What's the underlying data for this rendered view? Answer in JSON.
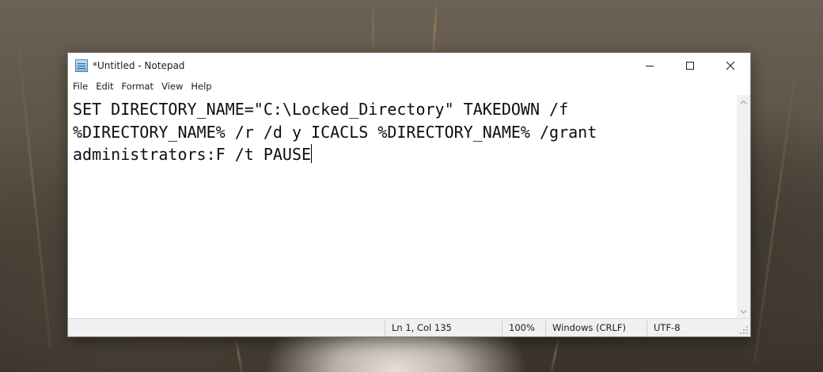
{
  "window": {
    "title": "*Untitled - Notepad",
    "icon": "notepad-icon",
    "buttons": {
      "minimize": "minimize-icon",
      "maximize": "maximize-icon",
      "close": "close-icon"
    }
  },
  "menu": {
    "items": [
      "File",
      "Edit",
      "Format",
      "View",
      "Help"
    ]
  },
  "editor": {
    "content": "SET DIRECTORY_NAME=\"C:\\Locked_Directory\" TAKEDOWN /f %DIRECTORY_NAME% /r /d y ICACLS %DIRECTORY_NAME% /grant administrators:F /t PAUSE"
  },
  "status": {
    "position": "Ln 1, Col 135",
    "zoom": "100%",
    "line_ending": "Windows (CRLF)",
    "encoding": "UTF-8"
  }
}
